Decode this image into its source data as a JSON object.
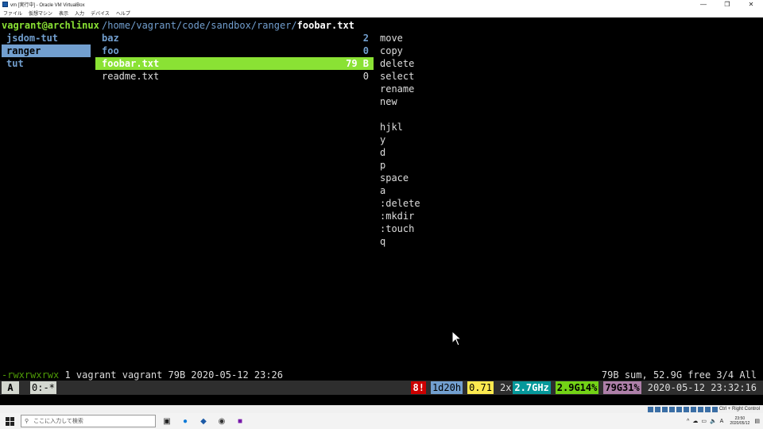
{
  "window": {
    "title": "vm [実行中] - Oracle VM VirtualBox",
    "minimize": "—",
    "maximize": "❐",
    "close": "✕"
  },
  "menubar": [
    "ファイル",
    "仮想マシン",
    "表示",
    "入力",
    "デバイス",
    "ヘルプ"
  ],
  "ranger": {
    "header": {
      "user": "vagrant@archlinux",
      "path": "/home/vagrant/code/sandbox/ranger/",
      "file": "foobar.txt"
    },
    "parent_dirs": [
      {
        "name": "jsdom-tut"
      },
      {
        "name": "ranger"
      },
      {
        "name": "tut"
      }
    ],
    "current_dir": [
      {
        "name": "baz",
        "size": "2"
      },
      {
        "name": "foo",
        "size": "0"
      },
      {
        "name": "foobar.txt",
        "size": "79 B"
      },
      {
        "name": "readme.txt",
        "size": "0"
      }
    ],
    "preview_lines": [
      "move",
      "copy",
      "delete",
      "select",
      "rename",
      "new",
      "",
      "hjkl",
      "y",
      "d",
      "p",
      "space",
      "a",
      ":delete",
      ":mkdir",
      ":touch",
      "q"
    ],
    "status": {
      "permissions": "-rwxrwxrwx",
      "info": " 1 vagrant vagrant 79B 2020-05-12 23:26",
      "summary": "79B sum, 52.9G free  3/4  All"
    }
  },
  "tmux": {
    "session": "A",
    "window": "0:-*",
    "alerts": "8!",
    "uptime": "1d20h",
    "load": "0.71",
    "cpu_count": "2x",
    "cpu_freq": "2.7GHz",
    "mem": "2.9G14%",
    "disk": "79G31%",
    "datetime": "2020-05-12 23:32:16"
  },
  "host_strip": {
    "hostkey": "Ctrl + Right Control"
  },
  "taskbar": {
    "search_placeholder": "ここに入力して検索",
    "clock_time": "23:50",
    "clock_date": "2020/05/12"
  }
}
